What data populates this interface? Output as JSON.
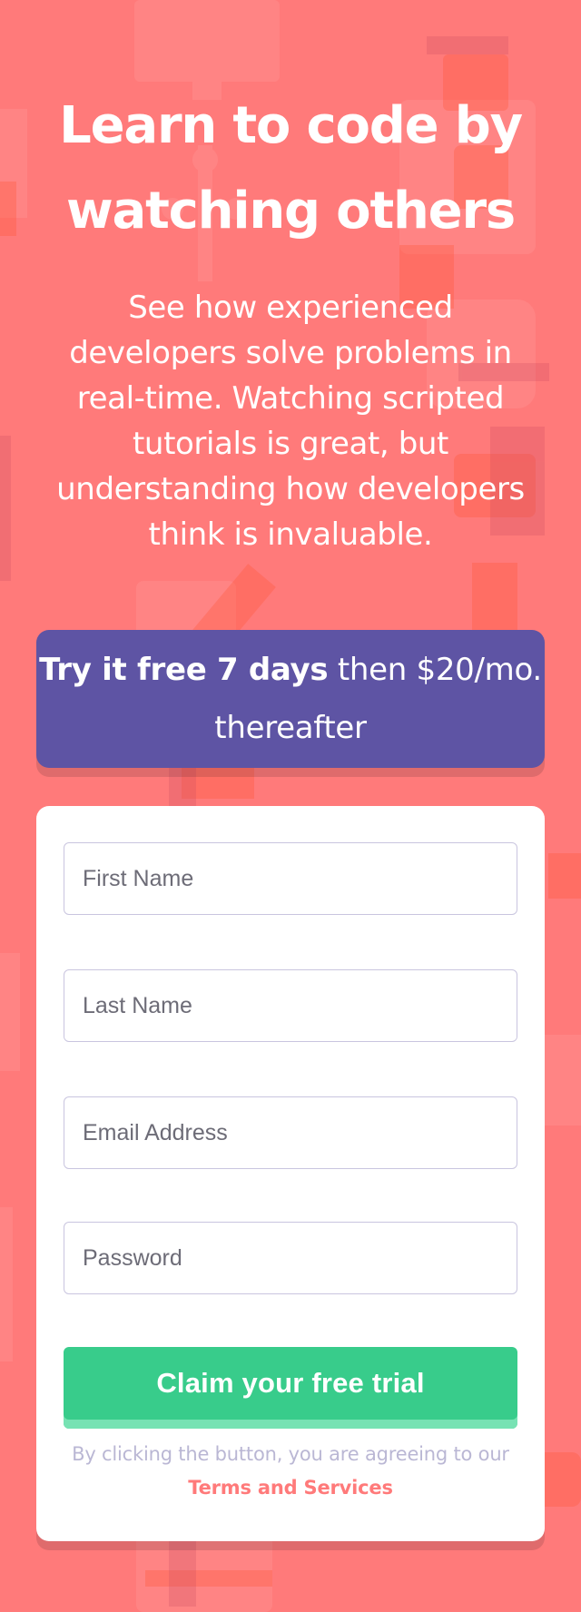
{
  "hero": {
    "title": "Learn to code by watching others",
    "description": "See how experienced developers solve problems in real-time. Watching scripted tutorials is great, but understanding how developers think is invaluable."
  },
  "offer": {
    "emphasis": "Try it free 7 days",
    "rest": " then $20/mo. thereafter"
  },
  "form": {
    "first_name_placeholder": "First Name",
    "last_name_placeholder": "Last Name",
    "email_placeholder": "Email Address",
    "password_placeholder": "Password",
    "submit_label": "Claim your free trial",
    "terms_prefix": "By clicking the button, you are agreeing to our ",
    "terms_link": "Terms and Services"
  },
  "colors": {
    "background": "#ff7a7a",
    "offer_background": "#5e54a4",
    "button": "#38cc8b",
    "link": "#ff7a7a",
    "muted_text": "#bab7d4"
  }
}
